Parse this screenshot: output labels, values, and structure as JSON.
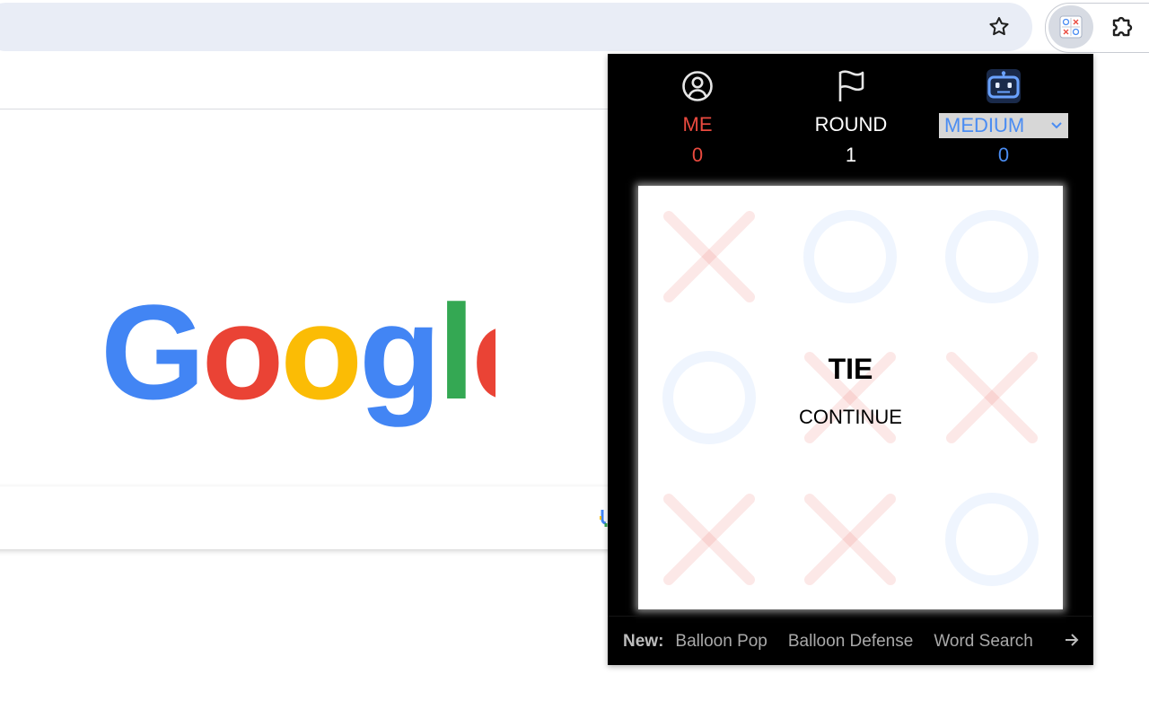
{
  "browser": {
    "star_icon": "star-icon",
    "extension_icon": "tic-tac-toe-extension-icon",
    "puzzle_icon": "extensions-puzzle-icon"
  },
  "google": {
    "logo_text": "Google",
    "logo_colors": [
      "#4285F4",
      "#EA4335",
      "#FBBC05",
      "#4285F4",
      "#34A853",
      "#EA4335"
    ]
  },
  "game": {
    "player": {
      "label": "ME",
      "score": "0",
      "icon": "user-circle-icon",
      "color": "#ea4a3f"
    },
    "round": {
      "label": "ROUND",
      "value": "1",
      "icon": "flag-icon"
    },
    "opponent": {
      "difficulty": "MEDIUM",
      "score": "0",
      "icon": "robot-icon",
      "color": "#4a8cf2"
    },
    "board": [
      "X",
      "O",
      "O",
      "O",
      "X",
      "X",
      "X",
      "X",
      "O"
    ],
    "result": {
      "title": "TIE",
      "action": "CONTINUE"
    }
  },
  "footer": {
    "prefix": "New:",
    "links": [
      "Balloon Pop",
      "Balloon Defense",
      "Word Search"
    ],
    "arrow_icon": "arrow-right-icon"
  }
}
